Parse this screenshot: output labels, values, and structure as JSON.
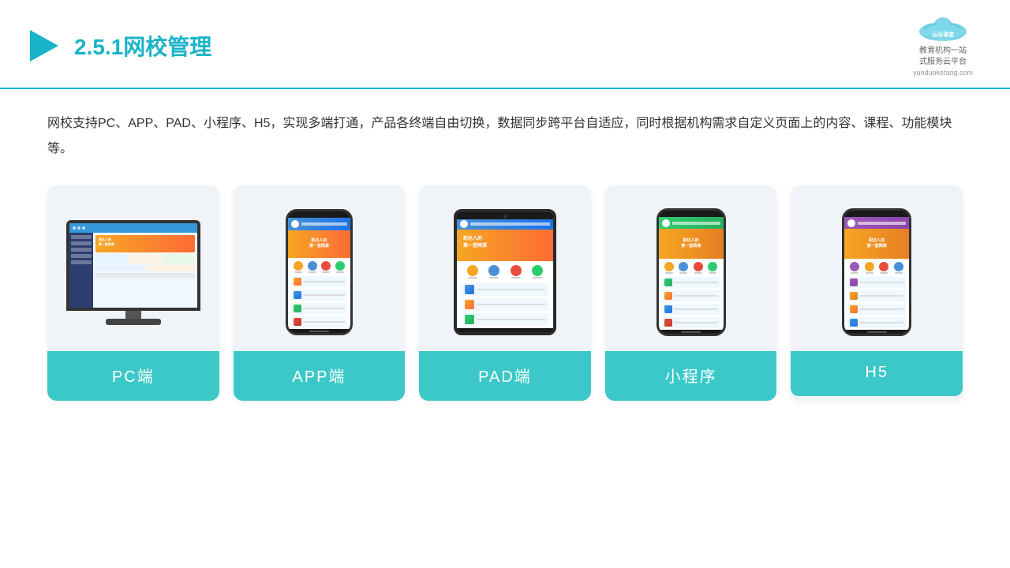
{
  "header": {
    "section_number": "2.5.1",
    "title_text": "网校管理",
    "logo_name": "云朵课堂",
    "logo_url": "yunduoketang.com",
    "logo_tagline": "教育机构一站\n式服务云平台"
  },
  "description": "网校支持PC、APP、PAD、小程序、H5，实现多端打通，产品各终端自由切换，数据同步跨平台自适应，同时根据机构需求自定义页面上的内容、课程、功能模块等。",
  "cards": [
    {
      "id": "pc",
      "label": "PC端"
    },
    {
      "id": "app",
      "label": "APP端"
    },
    {
      "id": "pad",
      "label": "PAD端"
    },
    {
      "id": "miniprogram",
      "label": "小程序"
    },
    {
      "id": "h5",
      "label": "H5"
    }
  ]
}
